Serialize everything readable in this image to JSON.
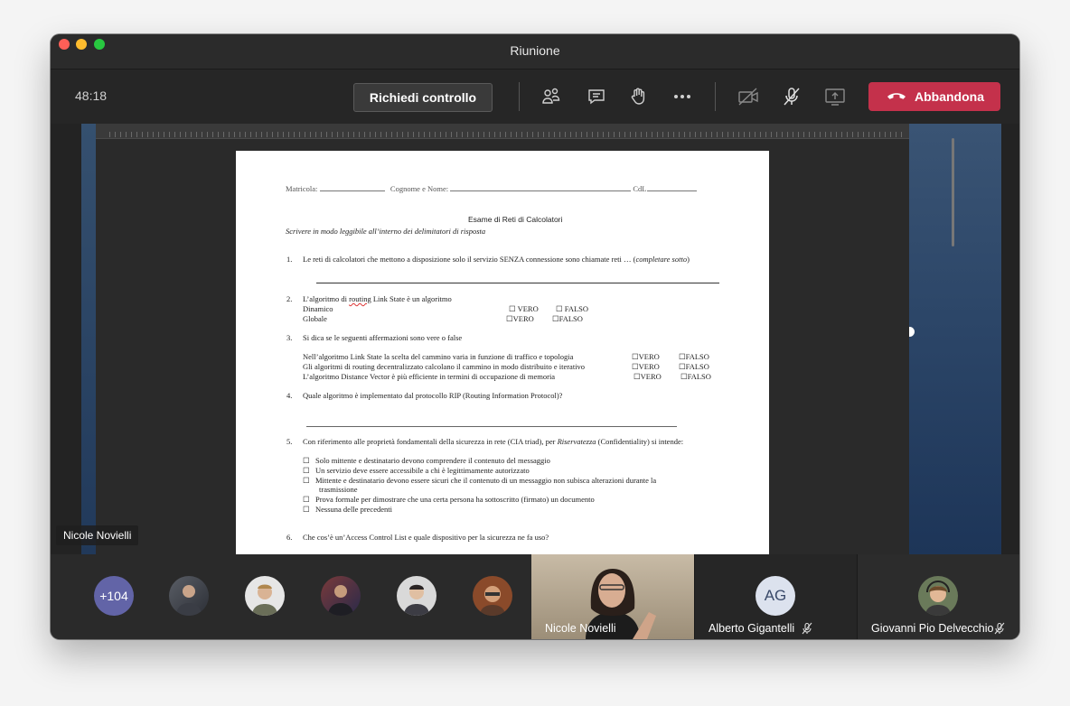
{
  "window": {
    "title": "Riunione"
  },
  "toolbar": {
    "timer": "48:18",
    "request_control_label": "Richiedi controllo",
    "leave_label": "Abbandona",
    "icons": [
      "participants-icon",
      "chat-icon",
      "raise-hand-icon",
      "more-options-icon",
      "camera-off-icon",
      "mic-off-icon",
      "share-screen-icon"
    ],
    "leave_color": "#c4314b"
  },
  "shared_document": {
    "header": {
      "matricola": "Matricola:",
      "cognome": "Cognome e Nome:",
      "cdl": "CdL"
    },
    "title": "Esame di Reti di Calcolatori",
    "instructions": "Scrivere in modo leggibile all’interno dei delimitatori di risposta",
    "questions": [
      {
        "num": "1.",
        "text": "Le reti di calcolatori che mettono a disposizione solo il servizio SENZA connessione sono chiamate reti  … (",
        "text_italic": "completare sotto",
        "text_end": ")"
      },
      {
        "num": "2.",
        "text": "L’algoritmo di ",
        "text_under": "routing",
        "text_end": " Link State è un algoritmo",
        "rows": [
          {
            "label": "Dinamico",
            "opt1": "VERO",
            "opt2": "FALSO"
          },
          {
            "label": "Globale",
            "opt1": "VERO",
            "opt2": "FALSO"
          }
        ]
      },
      {
        "num": "3.",
        "text": "Si dica se le seguenti affermazioni sono vere o false",
        "rows": [
          {
            "label": "Nell’algoritmo Link State la scelta del cammino varia in funzione di traffico e topologia",
            "opt1": "VERO",
            "opt2": "FALSO"
          },
          {
            "label": "Gli algoritmi di routing decentralizzato calcolano il cammino in modo distribuito e iterativo",
            "opt1": "VERO",
            "opt2": "FALSO"
          },
          {
            "label": "L’algoritmo Distance Vector è più efficiente in termini di occupazione di memoria",
            "opt1": "VERO",
            "opt2": "FALSO"
          }
        ]
      },
      {
        "num": "4.",
        "text": "Quale algoritmo è implementato dal protocollo RIP (Routing Information Protocol)?"
      },
      {
        "num": "5.",
        "text": "Con riferimento alle proprietà fondamentali della sicurezza in rete (CIA triad), per ",
        "text_italic": "Riservatezza",
        "text_end": " (Confidentiality) si intende:",
        "options": [
          "Solo mittente e destinatario devono comprendere il contenuto del messaggio",
          "Un servizio deve essere accessibile a chi è legittimamente autorizzato",
          "Mittente e destinatario devono essere sicuri che il contenuto di un messaggio non subisca alterazioni durante la",
          "trasmissione",
          "Prova formale per dimostrare che una certa persona ha sottoscritto (firmato) un documento",
          "Nessuna delle precedenti"
        ]
      },
      {
        "num": "6.",
        "text": "Che cos’è un’Access Control List e quale dispositivo per la sicurezza ne fa uso?"
      }
    ]
  },
  "presenter_name": "Nicole Novielli",
  "participants": {
    "more_count": "+104",
    "tiles": [
      {
        "name": "Nicole Novielli",
        "type": "video"
      },
      {
        "name": "Alberto Gigantelli",
        "initials": "AG",
        "muted": true
      },
      {
        "name": "Giovanni Pio Delvecchio",
        "muted": true
      }
    ]
  }
}
